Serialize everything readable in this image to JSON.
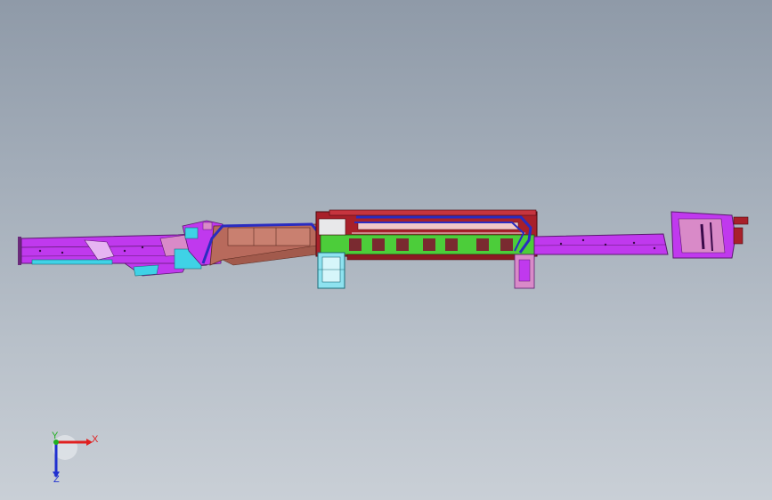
{
  "viewport": {
    "background_top": "#8f9aa8",
    "background_bottom": "#c9cfd6"
  },
  "model": {
    "colors": {
      "frame_rail": "#c039ee",
      "frame_outline": "#5a1a6e",
      "brown_body": "#b86a5c",
      "maroon_body": "#a8202a",
      "green_body": "#4ccd3a",
      "cyan_part": "#3fd2e6",
      "blue_line": "#2a2cc0",
      "pink_part": "#d98ac8",
      "white_part": "#f0f0f0"
    }
  },
  "triad": {
    "x_label": "X",
    "y_label": "Y",
    "z_label": "Z",
    "x_color": "#e02020",
    "y_color": "#20b020",
    "z_color": "#2030d0"
  }
}
